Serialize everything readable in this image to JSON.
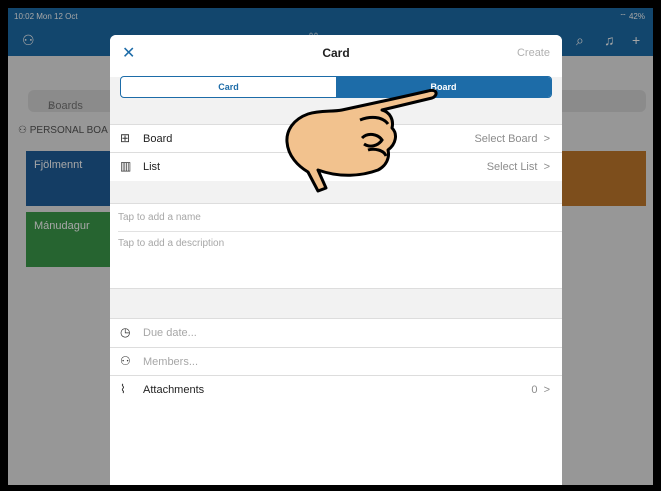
{
  "status": {
    "time": "10:02  Mon 12 Oct",
    "battery": "42%"
  },
  "background": {
    "search_placeholder": "Boards",
    "section": "PERSONAL BOA",
    "boards": [
      {
        "name": "Fjölmennt",
        "color": "#1f5e9a"
      },
      {
        "name": "Mánudagur",
        "color": "#3b9a4b"
      }
    ],
    "orange_tile_color": "#c0792b"
  },
  "modal": {
    "title": "Card",
    "close": "✕",
    "create": "Create",
    "segments": {
      "card": "Card",
      "board": "Board"
    },
    "board_row": {
      "label": "Board",
      "value": "Select Board"
    },
    "list_row": {
      "label": "List",
      "value": "Select List"
    },
    "name_placeholder": "Tap to add a name",
    "description_placeholder": "Tap to add a description",
    "due_date": "Due date...",
    "members": "Members...",
    "attachments": {
      "label": "Attachments",
      "value": "0"
    },
    "chevron": ">"
  }
}
